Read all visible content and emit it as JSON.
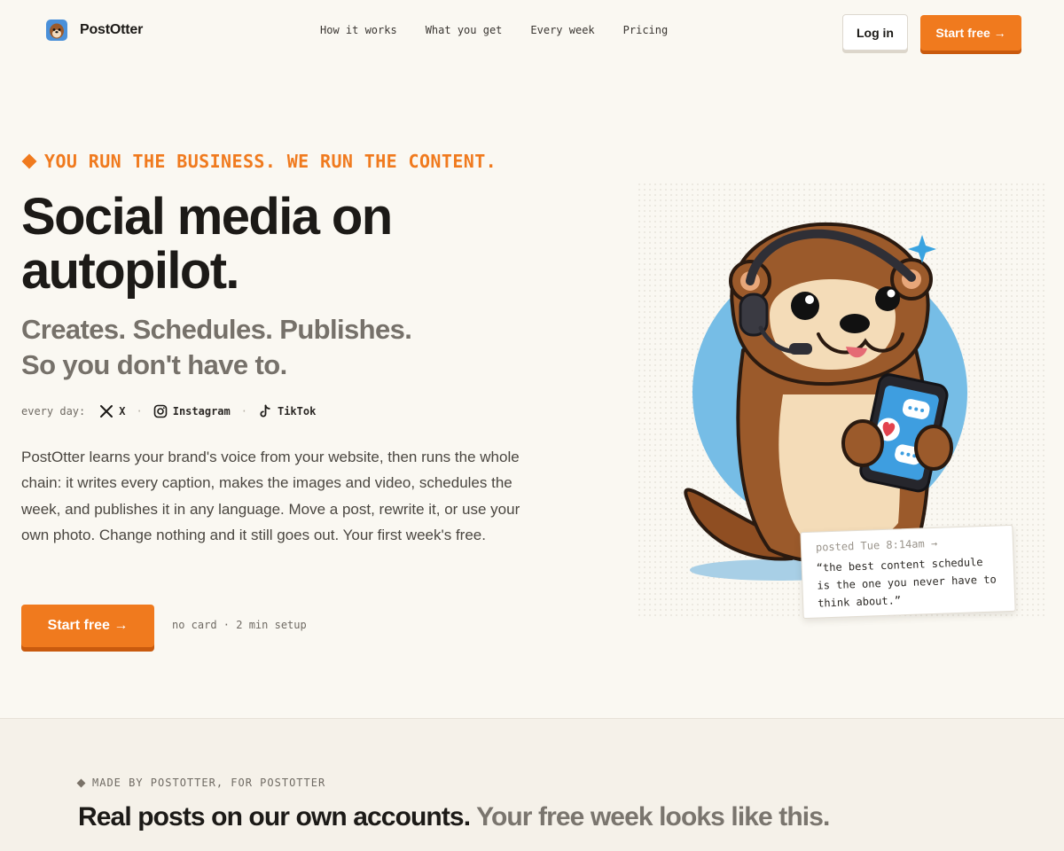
{
  "nav": {
    "brand_name": "PostOtter",
    "links": [
      "How it works",
      "What you get",
      "Every week",
      "Pricing"
    ],
    "login_label": "Log in",
    "start_label": "Start free →"
  },
  "hero": {
    "eyebrow": "YOU RUN THE BUSINESS. WE RUN THE CONTENT.",
    "headline": "Social media on autopilot.",
    "subhead_line1": "Creates. Schedules. Publishes.",
    "subhead_line2": "So you don't have to.",
    "platforms_label": "every day:",
    "platforms": [
      {
        "name": "X",
        "icon": "x-icon"
      },
      {
        "name": "Instagram",
        "icon": "instagram-icon"
      },
      {
        "name": "TikTok",
        "icon": "tiktok-icon"
      }
    ],
    "platform_separator": "·",
    "body": "PostOtter learns your brand's voice from your website, then runs the whole chain: it writes every caption, makes the images and video, schedules the week, and publishes it in any language. Move a post, rewrite it, or use your own photo. Change nothing and it still goes out. Your first week's free.",
    "cta_label": "Start free →",
    "cta_note": "no card · 2 min setup"
  },
  "post_card": {
    "meta": "posted Tue 8:14am →",
    "quote": "“the best content schedule is the one you never have to think about.”"
  },
  "section2": {
    "eyebrow": "MADE BY POSTOTTER, FOR POSTOTTER",
    "title_main": "Real posts on our own accounts.",
    "title_muted": "Your free week looks like this."
  },
  "colors": {
    "accent": "#f07a1e",
    "accent_shadow": "#c95a0e",
    "background": "#faf8f2",
    "text": "#1c1a17",
    "muted": "#76716a"
  }
}
